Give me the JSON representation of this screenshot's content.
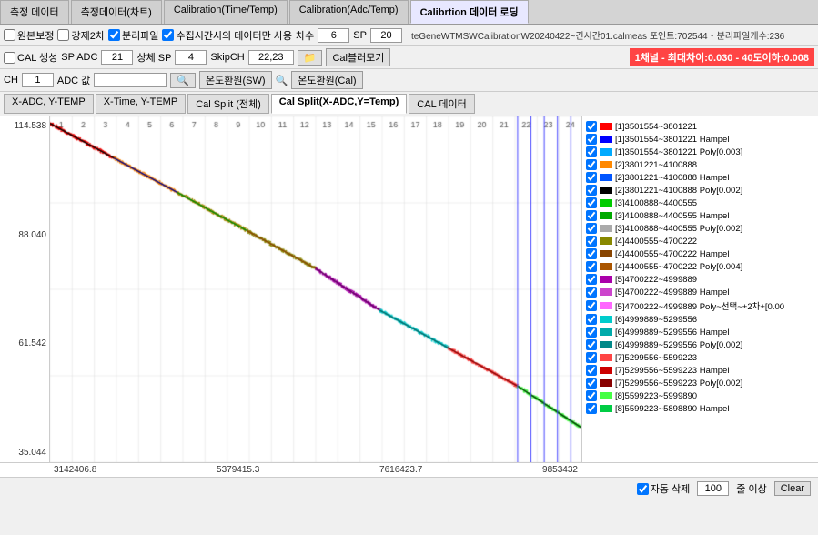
{
  "tabs": [
    {
      "label": "측정 데이터",
      "active": false
    },
    {
      "label": "측정데이터(차트)",
      "active": false
    },
    {
      "label": "Calibration(Time/Temp)",
      "active": false
    },
    {
      "label": "Calibration(Adc/Temp)",
      "active": false
    },
    {
      "label": "Calibrtion 데이터 로딩",
      "active": true
    }
  ],
  "toolbar1": {
    "checkbox1": {
      "label": "원본보정",
      "checked": false
    },
    "checkbox2": {
      "label": "강제2차",
      "checked": false
    },
    "checkbox3": {
      "label": "분리파일",
      "checked": true
    },
    "checkbox4": {
      "label": "수집시간시의 데이터만 사용",
      "checked": true
    },
    "label_count": "차수",
    "value_count": "6",
    "label_sp": "SP",
    "value_sp": "20",
    "header_info": "teGeneWTMSWCalibrationW20240422~긴시간01.calmeas 포인트:702544・분리파일개수:236"
  },
  "toolbar2": {
    "checkbox_cal": {
      "label": "CAL 생성",
      "checked": false
    },
    "label_sp_adc": "SP ADC",
    "value_sp_adc": "21",
    "label_sang_sp": "상체 SP",
    "value_sang_sp": "4",
    "label_skip_ch": "SkipCH",
    "value_skip_ch": "22,23",
    "btn_folder": "📁",
    "btn_cal": "Cal블러모기",
    "info_text": "1채널 - 최대차이:0.030 - 40도이하:0.008"
  },
  "toolbar3": {
    "label_ch": "CH",
    "value_ch": "1",
    "label_adc": "ADC 값",
    "btn_search": "🔍",
    "btn_temp_sw": "온도환원(SW)",
    "btn_temp_cal": "온도환원(Cal)"
  },
  "axis_tabs": [
    {
      "label": "X-ADC, Y-TEMP",
      "active": false
    },
    {
      "label": "X-Time, Y-TEMP",
      "active": false
    },
    {
      "label": "Cal Split (전체)",
      "active": false
    },
    {
      "label": "Cal Split(X-ADC,Y=Temp)",
      "active": true
    },
    {
      "label": "CAL 데이터",
      "active": false
    }
  ],
  "chart": {
    "y_max": "114.538",
    "y_mid1": "88.040",
    "y_mid2": "61.542",
    "y_min": "35.044",
    "x_min": "3142406.8",
    "x_mid1": "5379415.3",
    "x_mid2": "7616423.7",
    "x_max": "9853432",
    "col_labels": [
      "1",
      "2",
      "3",
      "4",
      "5",
      "6",
      "7",
      "8",
      "9",
      "10",
      "11",
      "12",
      "13",
      "14",
      "15",
      "16",
      "17",
      "18",
      "19",
      "20",
      "21",
      "22",
      "23",
      "24"
    ]
  },
  "legend": [
    {
      "color": "#ff0000",
      "text": "[1]3501554~3801221",
      "checked": true
    },
    {
      "color": "#0000ff",
      "text": "[1]3501554~3801221 Hampel",
      "checked": true
    },
    {
      "color": "#00aaff",
      "text": "[1]3501554~3801221 Poly[0.003]",
      "checked": true
    },
    {
      "color": "#ff8800",
      "text": "[2]3801221~4100888",
      "checked": true
    },
    {
      "color": "#0055ff",
      "text": "[2]3801221~4100888 Hampel",
      "checked": true
    },
    {
      "color": "#000000",
      "text": "[2]3801221~4100888 Poly[0.002]",
      "checked": true
    },
    {
      "color": "#00cc00",
      "text": "[3]4100888~4400555",
      "checked": true
    },
    {
      "color": "#00aa00",
      "text": "[3]4100888~4400555 Hampel",
      "checked": true
    },
    {
      "color": "#aaaaaa",
      "text": "[3]4100888~4400555 Poly[0.002]",
      "checked": true
    },
    {
      "color": "#888800",
      "text": "[4]4400555~4700222",
      "checked": true
    },
    {
      "color": "#884400",
      "text": "[4]4400555~4700222 Hampel",
      "checked": true
    },
    {
      "color": "#aa5500",
      "text": "[4]4400555~4700222 Poly[0.004]",
      "checked": true
    },
    {
      "color": "#aa00aa",
      "text": "[5]4700222~4999889",
      "checked": true
    },
    {
      "color": "#cc44cc",
      "text": "[5]4700222~4999889 Hampel",
      "checked": true
    },
    {
      "color": "#ff66ff",
      "text": "[5]4700222~4999889 Poly~선택~+2차+[0.00",
      "checked": true
    },
    {
      "color": "#00cccc",
      "text": "[6]4999889~5299556",
      "checked": true
    },
    {
      "color": "#00aaaa",
      "text": "[6]4999889~5299556 Hampel",
      "checked": true
    },
    {
      "color": "#008888",
      "text": "[6]4999889~5299556 Poly[0.002]",
      "checked": true
    },
    {
      "color": "#ff4444",
      "text": "[7]5299556~5599223",
      "checked": true
    },
    {
      "color": "#cc0000",
      "text": "[7]5299556~5599223 Hampel",
      "checked": true
    },
    {
      "color": "#880000",
      "text": "[7]5299556~5599223 Poly[0.002]",
      "checked": true
    },
    {
      "color": "#44ff44",
      "text": "[8]5599223~5999890",
      "checked": true
    },
    {
      "color": "#00cc44",
      "text": "[8]5599223~5898890 Hampel",
      "checked": true
    }
  ],
  "bottom": {
    "checkbox_auto": {
      "label": "자동 삭제",
      "checked": true
    },
    "input_rows": "100",
    "label_rows": "줄 이상",
    "btn_clear": "Clear"
  }
}
